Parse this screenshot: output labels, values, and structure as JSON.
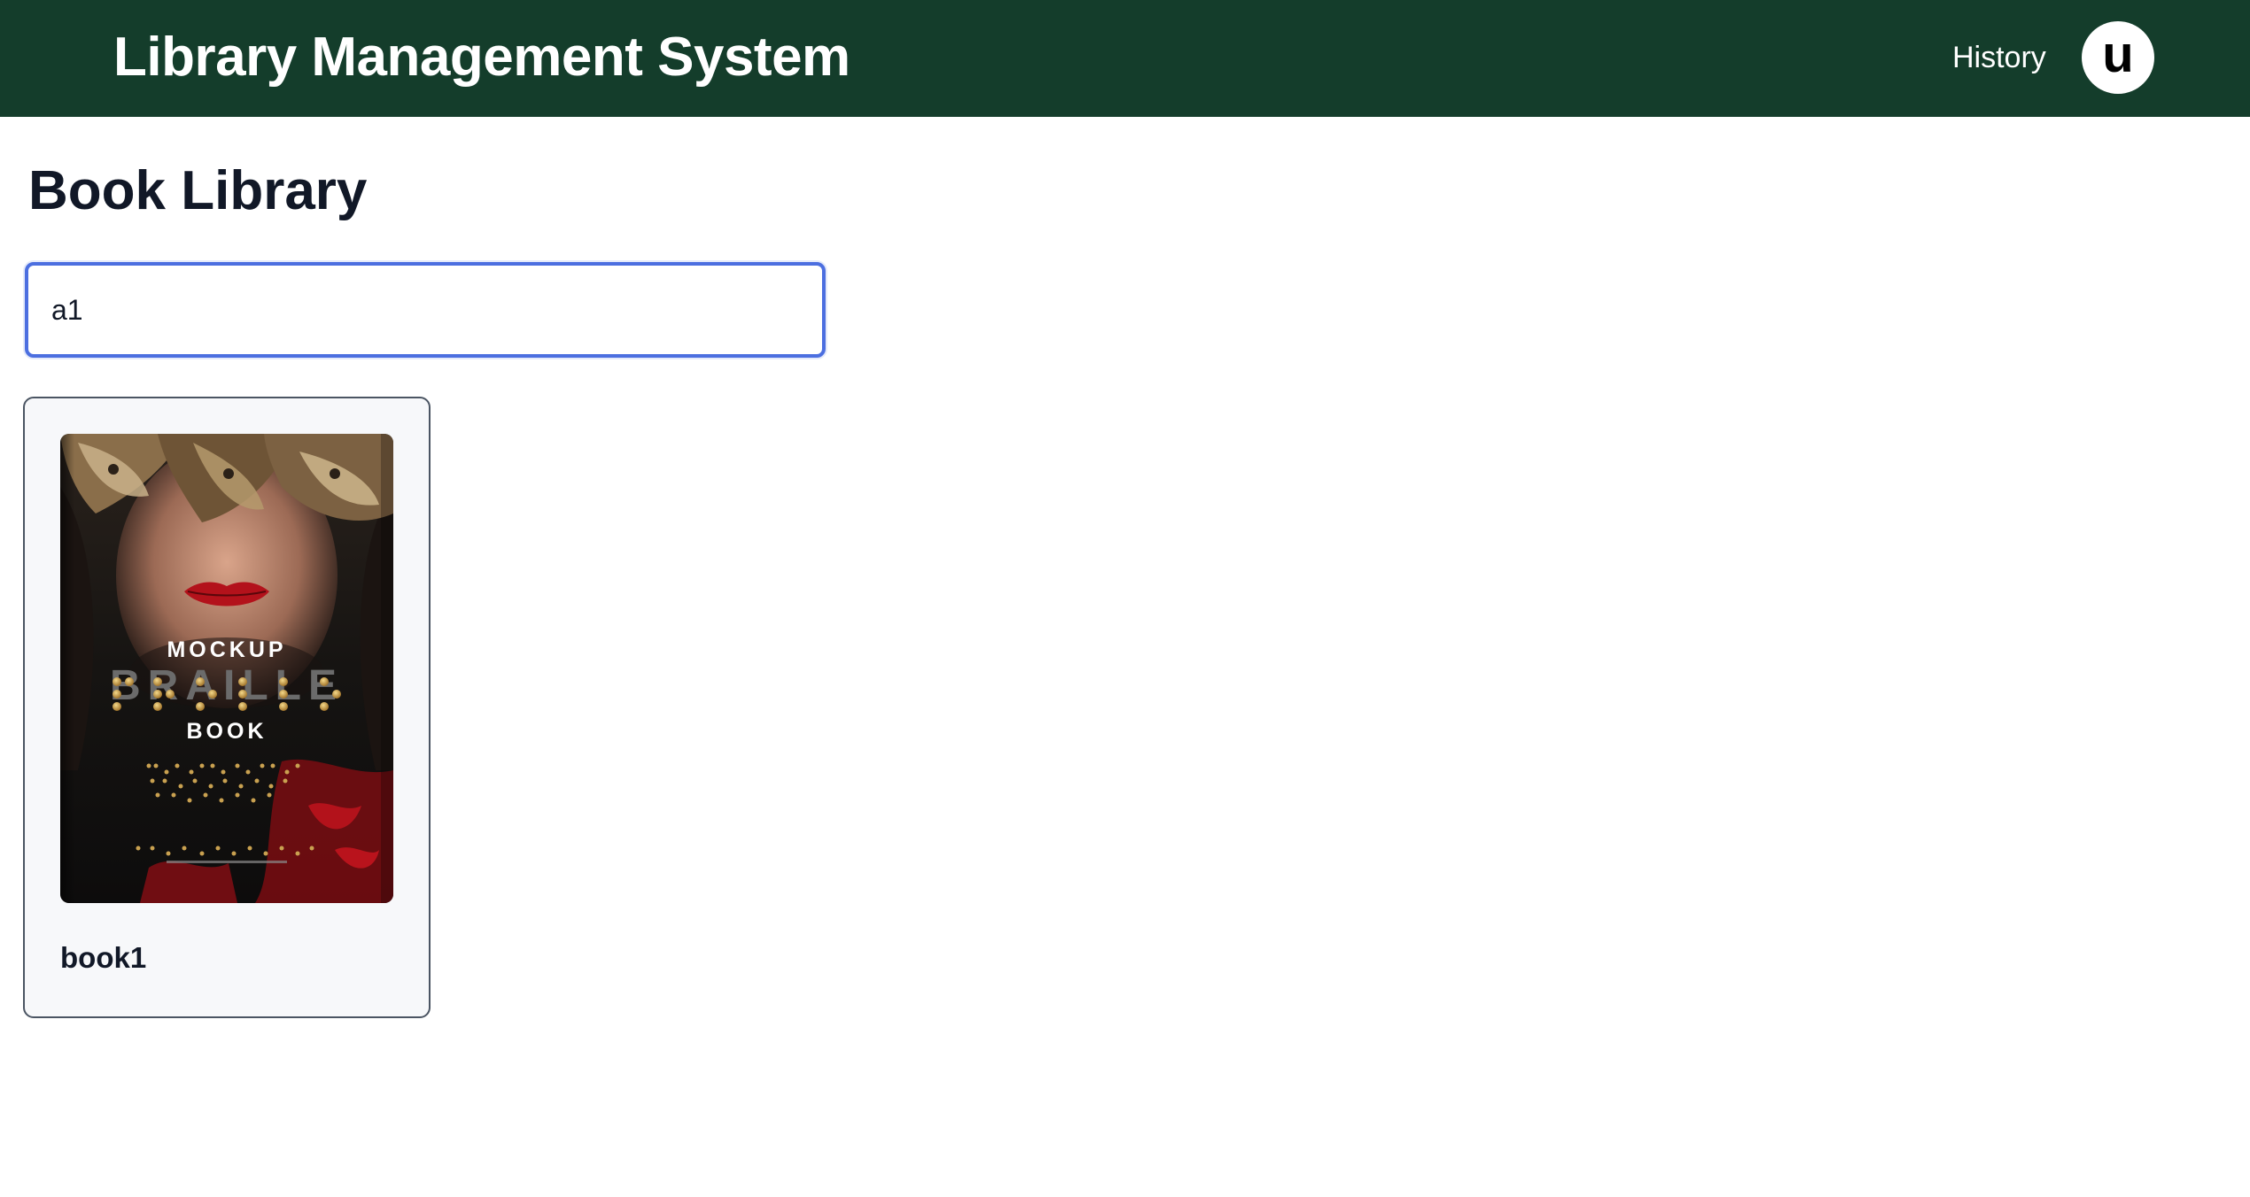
{
  "header": {
    "app_title": "Library Management System",
    "history_label": "History",
    "avatar_initial": "u",
    "background_color": "#143d2b"
  },
  "main": {
    "page_title": "Book Library",
    "search": {
      "value": "a1",
      "focus_color": "#4c6fe0"
    },
    "books": [
      {
        "title": "book1",
        "cover": {
          "line1": "MOCKUP",
          "line2": "BRAILLE",
          "line3": "BOOK"
        }
      }
    ]
  }
}
